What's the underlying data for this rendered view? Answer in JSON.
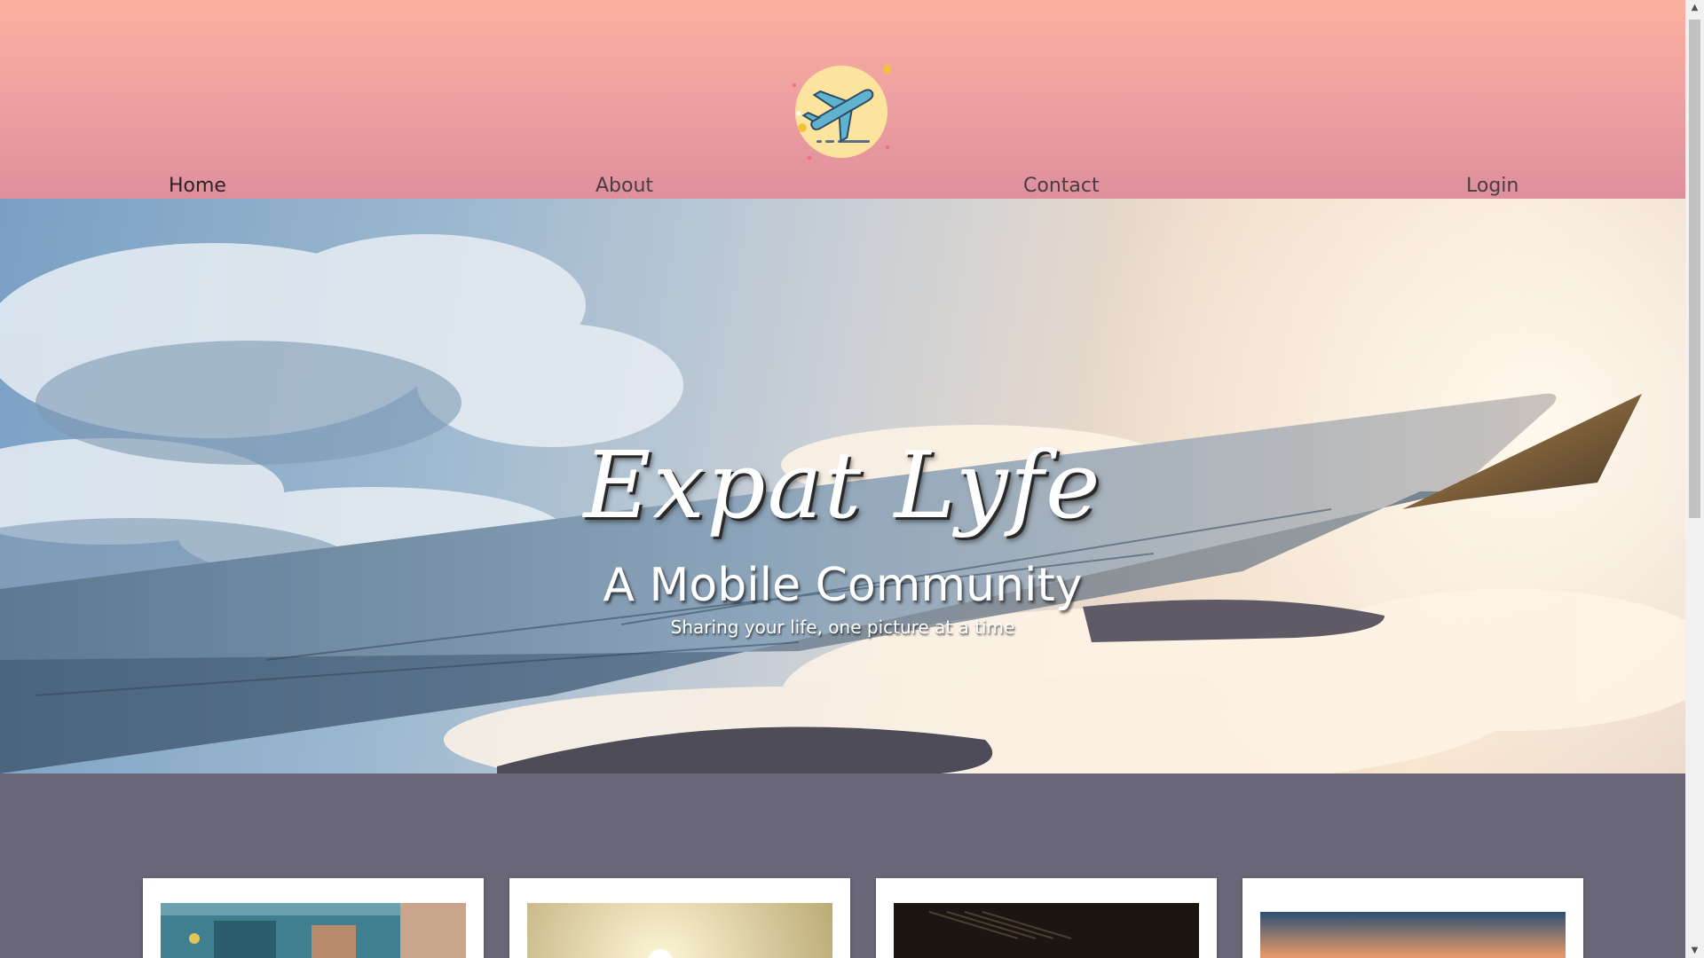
{
  "nav": {
    "items": [
      {
        "label": "Home",
        "active": true
      },
      {
        "label": "About",
        "active": false
      },
      {
        "label": "Contact",
        "active": false
      },
      {
        "label": "Login",
        "active": false
      }
    ]
  },
  "logo": {
    "icon": "airplane-icon",
    "colors": {
      "circle": "#fde49e",
      "plane": "#5fb3cf",
      "sparkle": "#f4c13b"
    }
  },
  "hero": {
    "title": "Expat Lyfe",
    "subtitle": "A Mobile Community",
    "tagline": "Sharing your life, one picture at a time"
  },
  "cards": [
    {
      "name": "photo-card-1"
    },
    {
      "name": "photo-card-2"
    },
    {
      "name": "photo-card-3"
    },
    {
      "name": "photo-card-4"
    }
  ],
  "colors": {
    "header_top": "#fbb19f",
    "header_bottom": "#de8f9d",
    "content_bg": "#686677"
  }
}
